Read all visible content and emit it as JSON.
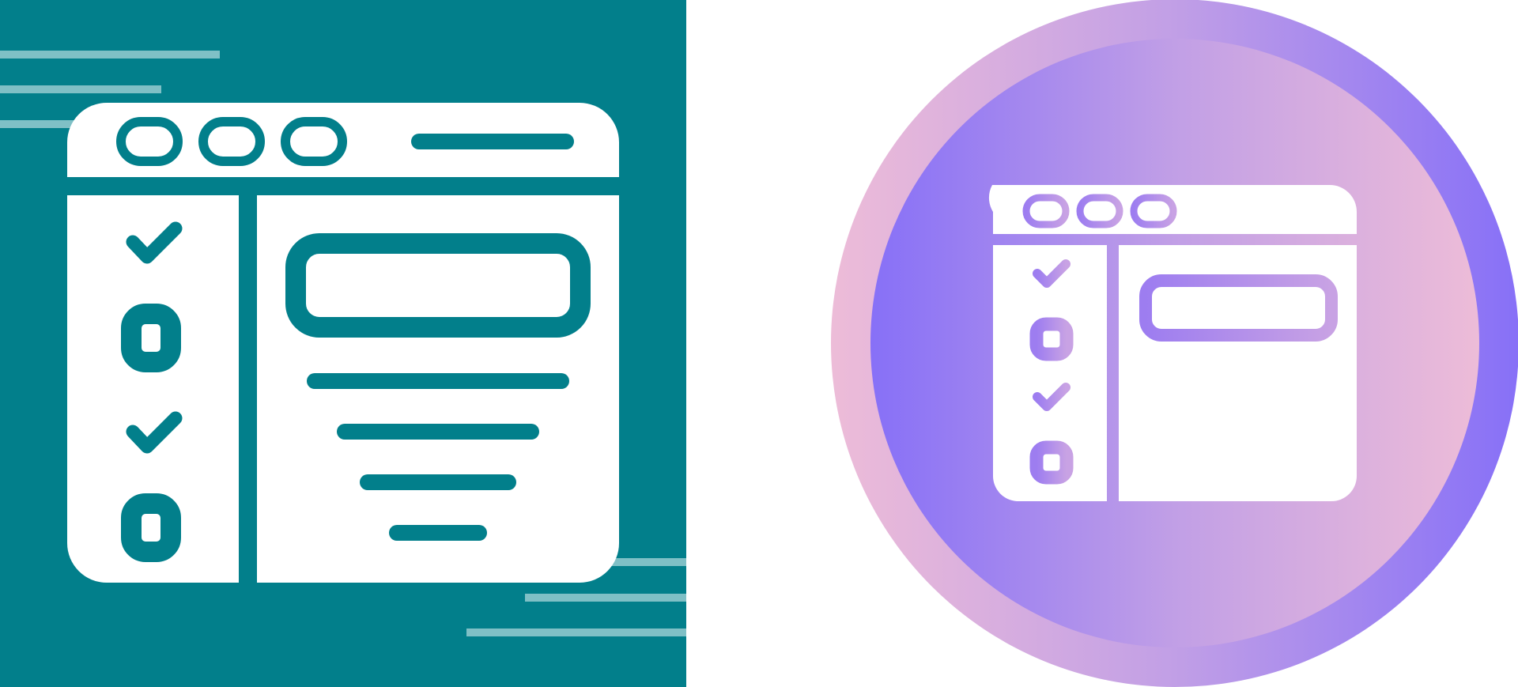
{
  "icons": [
    {
      "name": "checklist-browser-icon-flat",
      "style": "flat-teal",
      "colors": {
        "background": "#027F8B",
        "foreground": "#FFFFFF",
        "accent_lines": "#7FC0C6"
      },
      "checklist": [
        "checked",
        "unchecked",
        "checked",
        "unchecked"
      ]
    },
    {
      "name": "checklist-browser-icon-gradient",
      "style": "gradient-circle",
      "colors": {
        "gradient_pink": "#EDBCD8",
        "gradient_violet": "#8770F7",
        "foreground": "#FFFFFF"
      },
      "checklist": [
        "checked",
        "unchecked",
        "checked",
        "unchecked"
      ]
    }
  ]
}
